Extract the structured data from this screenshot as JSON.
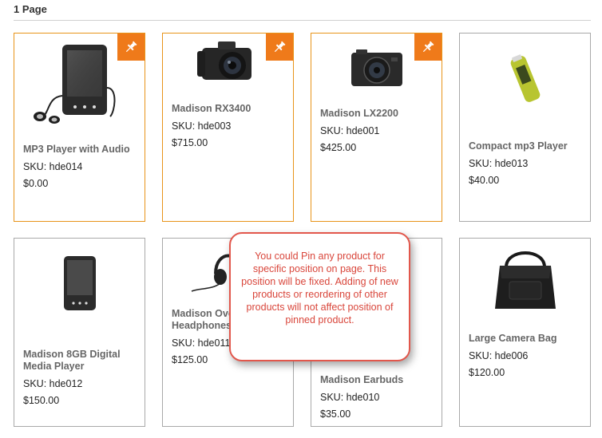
{
  "header": {
    "title": "1 Page"
  },
  "products": [
    {
      "name": "MP3 Player with Audio",
      "sku": "SKU: hde014",
      "price": "$0.00",
      "pinned": true,
      "image": "mp3-player-with-earphones"
    },
    {
      "name": "Madison RX3400",
      "sku": "SKU: hde003",
      "price": "$715.00",
      "pinned": true,
      "image": "dslr-camera"
    },
    {
      "name": "Madison LX2200",
      "sku": "SKU: hde001",
      "price": "$425.00",
      "pinned": true,
      "image": "compact-camera"
    },
    {
      "name": "Compact mp3 Player",
      "sku": "SKU: hde013",
      "price": "$40.00",
      "pinned": false,
      "image": "usb-mp3-player"
    },
    {
      "name": "Madison 8GB Digital Media Player",
      "sku": "SKU: hde012",
      "price": "$150.00",
      "pinned": false,
      "image": "digital-media-player"
    },
    {
      "name": "Madison Over-Ear Headphones",
      "sku": "SKU: hde011",
      "price": "$125.00",
      "pinned": false,
      "image": "headphones"
    },
    {
      "name": "Madison Earbuds",
      "sku": "SKU: hde010",
      "price": "$35.00",
      "pinned": false,
      "image": "earbuds"
    },
    {
      "name": "Large Camera Bag",
      "sku": "SKU: hde006",
      "price": "$120.00",
      "pinned": false,
      "image": "camera-bag"
    }
  ],
  "tooltip": {
    "text": "You could Pin any product for specific position on page. This position will be fixed. Adding of new products or reordering of other products will not affect position of pinned product."
  },
  "colors": {
    "pin_badge": "#ef7a1a",
    "pinned_border": "#e8941a",
    "tooltip_border": "#e2574c",
    "tooltip_text": "#d9463b"
  },
  "icons": {
    "pin": "pushpin-icon"
  }
}
